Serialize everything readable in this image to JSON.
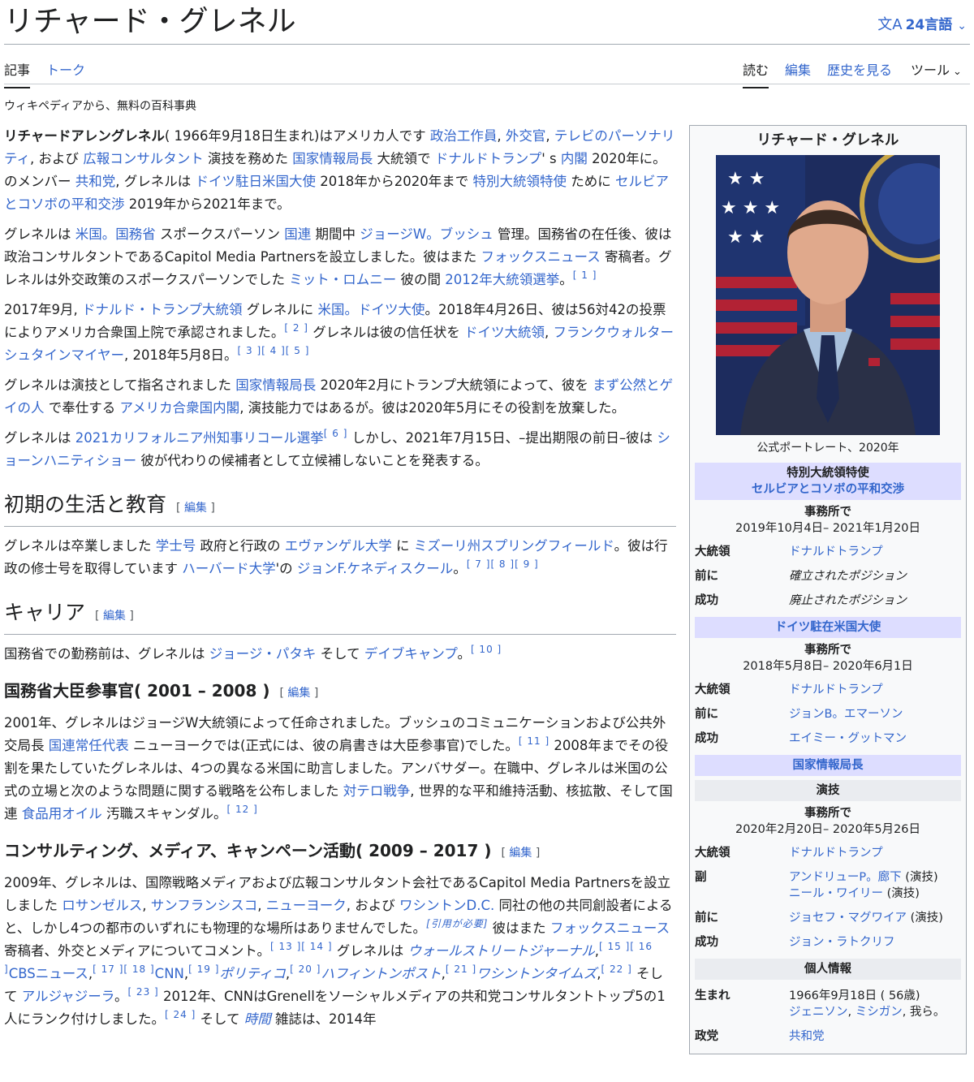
{
  "header": {
    "title": "リチャード・グレネル",
    "lang_label": "24言語",
    "lang_icon": "translate-icon"
  },
  "tabs": {
    "article": "記事",
    "talk": "トーク",
    "read": "読む",
    "edit": "編集",
    "history": "歴史を見る",
    "tools": "ツール"
  },
  "tagline": "ウィキペディアから、無料の百科事典",
  "edit_label": "編集",
  "intro": {
    "p1": {
      "name": "リチャードアレングレネル",
      "t1": "( 1966年9月18日生まれ)はアメリカ人です ",
      "l1": "政治工作員",
      "t2": ", ",
      "l2": "外交官",
      "t3": ", ",
      "l3": "テレビのパーソナリティ",
      "t4": ", および ",
      "l4": "広報コンサルタント",
      "t5": " 演技を務めた ",
      "l5": "国家情報局長",
      "t6": " 大統領で ",
      "l6": "ドナルドトランプ",
      "t7": "' s ",
      "l7": "内閣",
      "t8": " 2020年に。のメンバー ",
      "l8": "共和党",
      "t9": ", グレネルは ",
      "l9": "ドイツ駐日米国大使",
      "t10": " 2018年から2020年まで ",
      "l10": "特別大統領特使",
      "t11": " ために ",
      "l11": "セルビアとコソボの平和交渉",
      "t12": " 2019年から2021年まで。"
    },
    "p2": {
      "t1": "グレネルは ",
      "l1": "米国。国務省",
      "t2": " スポークスパーソン ",
      "l2": "国連",
      "t3": " 期間中 ",
      "l3": "ジョージW。ブッシュ",
      "t4": " 管理。国務省の在任後、彼は政治コンサルタントであるCapitol Media Partnersを設立しました。彼はまた ",
      "l4": "フォックスニュース",
      "t5": " 寄稿者。グレネルは外交政策のスポークスパーソンでした ",
      "l5": "ミット・ロムニー",
      "t6": " 彼の間 ",
      "l6": "2012年大統領選挙",
      "t7": "。",
      "r1": "[ 1 ]"
    },
    "p3": {
      "t1": "2017年9月, ",
      "l1": "ドナルド・トランプ大統領",
      "t2": " グレネルに ",
      "l2": "米国。ドイツ大使",
      "t3": "。2018年4月26日、彼は56対42の投票によりアメリカ合衆国上院で承認されました。",
      "r1": "[ 2 ]",
      "t4": " グレネルは彼の信任状を ",
      "l3": "ドイツ大統領",
      "t5": ", ",
      "l4": "フランクウォルターシュタインマイヤー",
      "t6": ", 2018年5月8日。",
      "r2": "[ 3 ][ 4 ][ 5 ]"
    },
    "p4": {
      "t1": "グレネルは演技として指名されました ",
      "l1": "国家情報局長",
      "t2": " 2020年2月にトランプ大統領によって、彼を ",
      "l2": "まず公然とゲイの人",
      "t3": " で奉仕する ",
      "l3": "アメリカ合衆国内閣",
      "t4": ", 演技能力ではあるが。彼は2020年5月にその役割を放棄した。"
    },
    "p5": {
      "t1": "グレネルは ",
      "l1": "2021カリフォルニア州知事リコール選挙",
      "r1": "[ 6 ]",
      "t2": " しかし、2021年7月15日、–提出期限の前日–彼は ",
      "l2": "ショーンハニティショー",
      "t3": " 彼が代わりの候補者として立候補しないことを発表する。"
    }
  },
  "early": {
    "heading": "初期の生活と教育",
    "t1": "グレネルは卒業しました ",
    "l1": "学士号",
    "t2": " 政府と行政の ",
    "l2": "エヴァンゲル大学",
    "t3": " に ",
    "l3": "ミズーリ州スプリングフィールド",
    "t4": "。彼は行政の修士号を取得しています ",
    "l4": "ハーバード大学",
    "t5": "'の ",
    "l5": "ジョンF.ケネディスクール",
    "t6": "。",
    "r1": "[ 7 ][ 8 ][ 9 ]"
  },
  "career": {
    "heading": "キャリア",
    "t1": "国務省での勤務前は、グレネルは ",
    "l1": "ジョージ・パタキ",
    "t2": " そして ",
    "l2": "デイブキャンプ",
    "t3": "。",
    "r1": "[ 10 ]"
  },
  "state": {
    "heading": "国務省大臣参事官( 2001 – 2008 )",
    "t1": "2001年、グレネルはジョージW大統領によって任命されました。ブッシュのコミュニケーションおよび公共外交局長 ",
    "l1": "国連常任代表",
    "t2": " ニューヨークでは(正式には、彼の肩書きは大臣参事官)でした。",
    "r1": "[ 11 ]",
    "t3": " 2008年までその役割を果たしていたグレネルは、4つの異なる米国に助言しました。アンバサダー。在職中、グレネルは米国の公式の立場と次のような問題に関する戦略を公布しました ",
    "l2": "対テロ戦争",
    "t4": ", 世界的な平和維持活動、核拡散、そして国連 ",
    "l3": "食品用オイル",
    "t5": " 汚職スキャンダル。",
    "r2": "[ 12 ]"
  },
  "consult": {
    "heading": "コンサルティング、メディア、キャンペーン活動( 2009 – 2017 )",
    "t1": "2009年、グレネルは、国際戦略メディアおよび広報コンサルタント会社であるCapitol Media Partnersを設立しました ",
    "l1": "ロサンゼルス",
    "t2": ", ",
    "l2": "サンフランシスコ",
    "t3": ", ",
    "l3": "ニューヨーク",
    "t4": ", および ",
    "l4": "ワシントンD.C.",
    "t5": " 同社の他の共同創設者によると、しかし4つの都市のいずれにも物理的な場所はありませんでした。",
    "cn": "[引用が必要]",
    "t6": " 彼はまた ",
    "l5": "フォックスニュース",
    "t7": " 寄稿者、外交とメディアについてコメント。",
    "r1": "[ 13 ][ 14 ]",
    "t8": " グレネルは ",
    "l6": "ウォールストリートジャーナル",
    "t9": ",",
    "r2": "[ 15 ][ 16 ]",
    "l7": "CBSニュース",
    "t10": ",",
    "r3": "[ 17 ][ 18 ]",
    "l8": "CNN",
    "t11": ",",
    "r4": "[ 19 ]",
    "l9": "ポリティコ",
    "t12": ",",
    "r5": "[ 20 ]",
    "l10": "ハフィントンポスト",
    "t13": ",",
    "r6": "[ 21 ]",
    "l11": "ワシントンタイムズ",
    "t14": ",",
    "r7": "[ 22 ]",
    "t15": " そして ",
    "l12": "アルジャジーラ",
    "t16": "。",
    "r8": "[ 23 ]",
    "t17": " 2012年、CNNはGrenellをソーシャルメディアの共和党コンサルタントトップ5の1人にランク付けしました。",
    "r9": "[ 24 ]",
    "t18": " そして ",
    "l13": "時間",
    "t19": " 雑誌は、2014年"
  },
  "infobox": {
    "title": "リチャード・グレネル",
    "caption": "公式ポートレート、2020年",
    "sec1_title": "特別大統領特使",
    "sec1_link": "セルビアとコソボの平和交渉",
    "in_office": "事務所で",
    "sec1_dates": "2019年10月4日– 2021年1月20日",
    "president_label": "大統領",
    "president_value": "ドナルドトランプ",
    "preceded_label": "前に",
    "succeeded_label": "成功",
    "sec1_preceded": "確立されたポジション",
    "sec1_succeeded": "廃止されたポジション",
    "sec2_title": "ドイツ駐在米国大使",
    "sec2_dates": "2018年5月8日– 2020年6月1日",
    "sec2_preceded": "ジョンB。エマーソン",
    "sec2_succeeded": "エイミー・グットマン",
    "sec3_title": "国家情報局長",
    "sec3_acting": "演技",
    "sec3_dates": "2020年2月20日– 2020年5月26日",
    "deputy_label": "副",
    "deputy1": "アンドリューP。廊下",
    "deputy2": "ニール・ワイリー",
    "acting_suffix": " (演技)",
    "sec3_preceded": "ジョセフ・マグワイア",
    "sec3_succeeded": "ジョン・ラトクリフ",
    "personal_title": "個人情報",
    "born_label": "生まれ",
    "born_value": "1966年9月18日 ( 56歳)",
    "born_place1": "ジェニソン",
    "born_place_sep": ", ",
    "born_place2": "ミシガン",
    "born_place3": ", 我ら。",
    "party_label": "政党",
    "party_value": "共和党"
  },
  "colors": {
    "link": "#3366cc",
    "band": "#ddddff",
    "infobox_bg": "#f8f9fa",
    "text": "#202122"
  },
  "icons": {
    "language": "translate-icon",
    "dropdown": "chevron-down-icon",
    "portrait": "portrait-image"
  }
}
